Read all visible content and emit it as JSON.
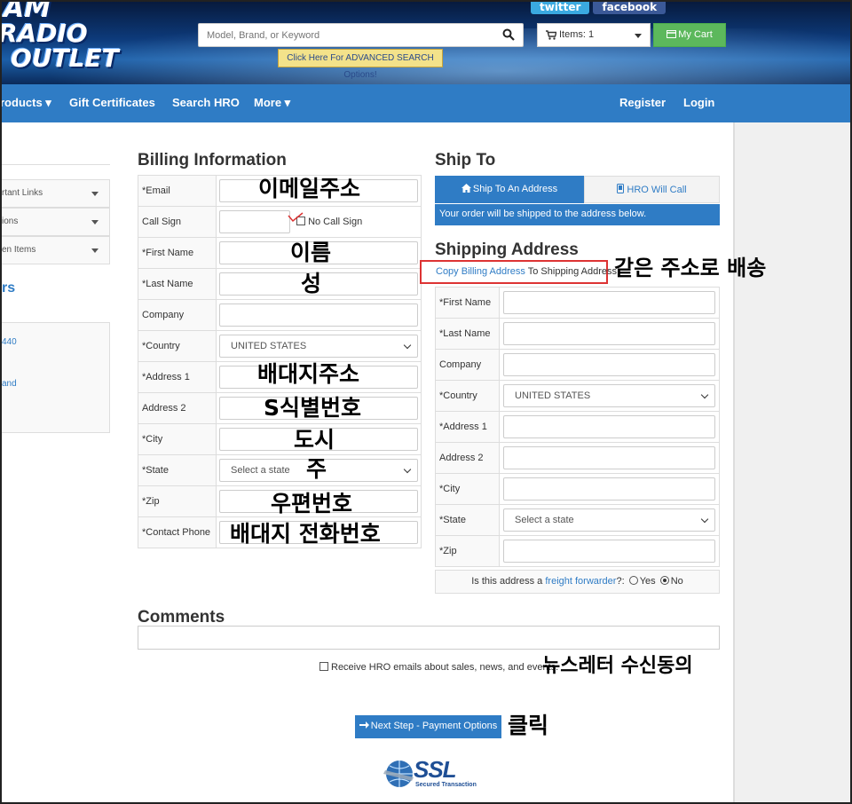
{
  "header": {
    "logo_line1": "AM",
    "logo_line2": "RADIO",
    "logo_line3": "OUTLET",
    "twitter": "twitter",
    "facebook": "facebook",
    "search_placeholder": "Model, Brand, or Keyword",
    "advanced_search": "Click Here For ADVANCED SEARCH Options!",
    "cart_items": "Items: 1",
    "my_cart": "My Cart"
  },
  "nav": {
    "products": "roducts",
    "gift_certificates": "Gift Certificates",
    "search_hro": "Search HRO",
    "more": "More",
    "register": "Register",
    "login": "Login"
  },
  "sidebar": {
    "items": [
      {
        "label": "rtant Links"
      },
      {
        "label": "ions"
      },
      {
        "label": "en Items"
      }
    ],
    "heading": "rs",
    "link1": "440",
    "link2": "and"
  },
  "billing": {
    "title": "Billing Information",
    "fields": {
      "email": "*Email",
      "call_sign": "Call Sign",
      "no_call_sign": "No Call Sign",
      "first_name": "*First Name",
      "last_name": "*Last Name",
      "company": "Company",
      "country": "*Country",
      "country_value": "UNITED STATES",
      "address1": "*Address 1",
      "address2": "Address 2",
      "city": "*City",
      "state": "*State",
      "state_value": "Select a state",
      "zip": "*Zip",
      "contact_phone": "*Contact Phone"
    }
  },
  "ship_to": {
    "title": "Ship To",
    "ship_to_address": "Ship To An Address",
    "hro_will_call": "HRO Will Call",
    "note": "Your order will be shipped to the address below.",
    "shipping_title": "Shipping Address",
    "copy_link": "Copy Billing Address",
    "copy_suffix": " To Shipping Address",
    "fields": {
      "first_name": "*First Name",
      "last_name": "*Last Name",
      "company": "Company",
      "country": "*Country",
      "country_value": "UNITED STATES",
      "address1": "*Address 1",
      "address2": "Address 2",
      "city": "*City",
      "state": "*State",
      "state_value": "Select a state",
      "zip": "*Zip"
    },
    "freight_prefix": "Is this address a ",
    "freight_link": "freight forwarder",
    "freight_suffix": "?:",
    "yes": "Yes",
    "no": "No",
    "no_selected": true
  },
  "comments": {
    "title": "Comments",
    "newsletter": "Receive HRO emails about sales, news, and events."
  },
  "next_button": "Next Step - Payment Options",
  "ssl": {
    "label": "SSL",
    "sub": "Secured Transaction"
  },
  "annotations": {
    "email": "이메일주소",
    "first_name": "이름",
    "last_name": "성",
    "address1": "배대지주소",
    "address2": "S식별번호",
    "city": "도시",
    "state": "주",
    "zip": "우편번호",
    "phone": "배대지 전화번호",
    "same_address": "같은 주소로 배송",
    "newsletter": "뉴스레터 수신동의",
    "click": "클릭"
  },
  "colors": {
    "nav": "#2f7cc5",
    "cart_button": "#5cb85c",
    "annotation_box": "#dd3333"
  }
}
